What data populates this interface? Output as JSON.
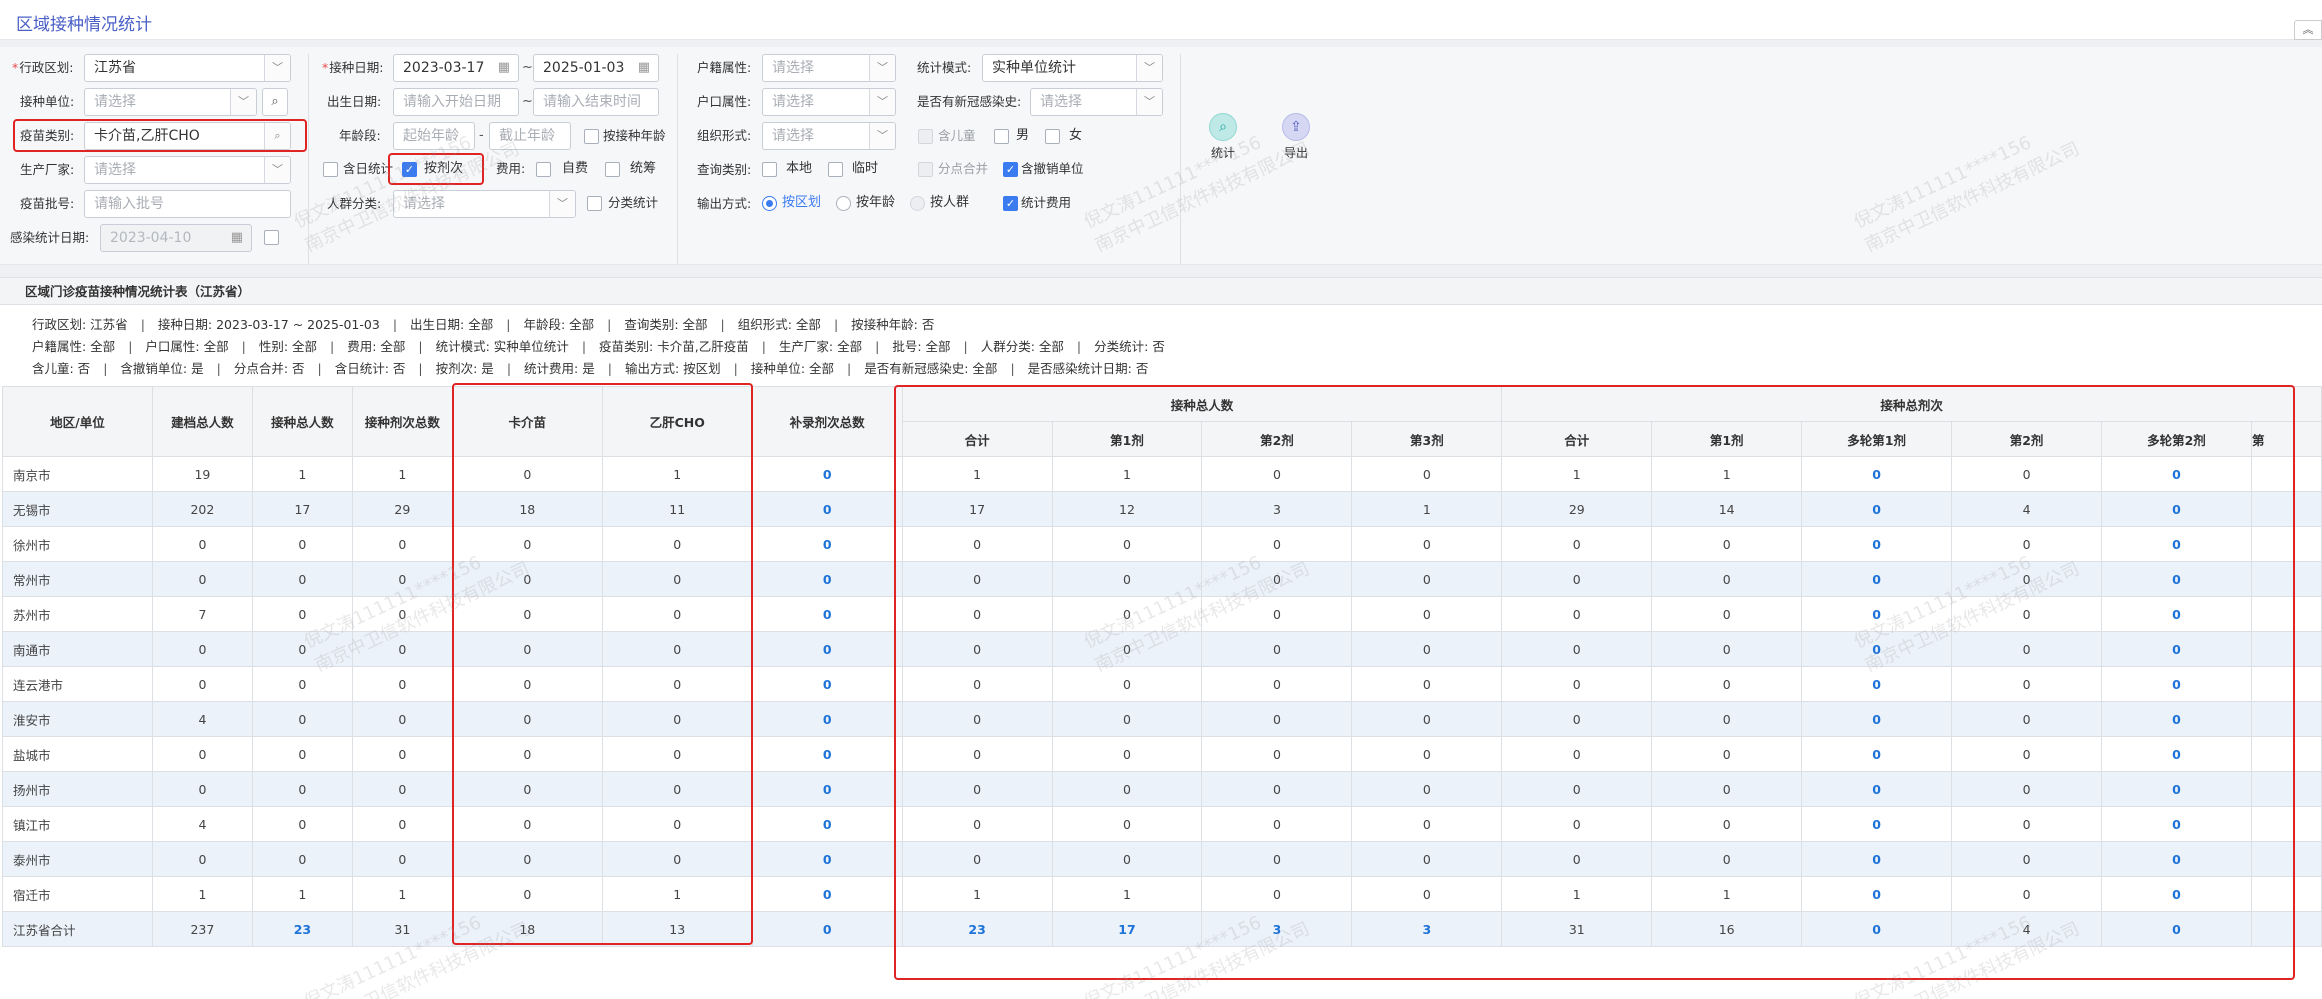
{
  "page": {
    "title": "区域接种情况统计",
    "collapse_icon": "chevrons-up-icon"
  },
  "filters": {
    "region_label": "行政区划:",
    "region_value": "江苏省",
    "unit_label": "接种单位:",
    "unit_ph": "请选择",
    "vaccine_type_label": "疫苗类别:",
    "vaccine_type_value": "卡介苗,乙肝CHO",
    "manufacturer_label": "生产厂家:",
    "manufacturer_ph": "请选择",
    "batch_label": "疫苗批号:",
    "batch_ph": "请输入批号",
    "infect_date_label": "感染统计日期:",
    "infect_date_value": "2023-04-10",
    "vacc_date_label": "接种日期:",
    "vacc_date_start": "2023-03-17",
    "vacc_date_end": "2025-01-03",
    "birth_label": "出生日期:",
    "birth_start_ph": "请输入开始日期",
    "birth_end_ph": "请输入结束时间",
    "age_label": "年龄段:",
    "age_start_ph": "起始年龄",
    "age_end_ph": "截止年龄",
    "by_vacc_age": "按接种年龄",
    "same_day": "含日统计",
    "by_dose": "按剂次",
    "fee_label": "费用:",
    "self_pay": "自费",
    "coord": "统筹",
    "crowd_label": "人群分类:",
    "crowd_ph": "请选择",
    "class_stat": "分类统计",
    "household_attr_label": "户籍属性:",
    "household_attr_ph": "请选择",
    "hukou_attr_label": "户口属性:",
    "hukou_attr_ph": "请选择",
    "org_form_label": "组织形式:",
    "org_form_ph": "请选择",
    "query_type_label": "查询类别:",
    "local": "本地",
    "temp": "临时",
    "output_label": "输出方式:",
    "by_region": "按区划",
    "by_age": "按年龄",
    "by_crowd": "按人群",
    "stat_mode_label": "统计模式:",
    "stat_mode_value": "实种单位统计",
    "covid_label": "是否有新冠感染史:",
    "covid_ph": "请选择",
    "child": "含儿童",
    "male": "男",
    "female": "女",
    "split_point": "分点合并",
    "cancel_unit": "含撤销单位",
    "stat_fee": "统计费用",
    "tilde": "~",
    "dash": "-"
  },
  "actions": {
    "stat": "统计",
    "export": "导出",
    "stat_icon": "search-icon",
    "export_icon": "upload-icon"
  },
  "report": {
    "title": "区域门诊疫苗接种情况统计表（江苏省）",
    "cond_rows": [
      [
        "行政区划: 江苏省",
        "接种日期: 2023-03-17 ~ 2025-01-03",
        "出生日期: 全部",
        "年龄段: 全部",
        "查询类别: 全部",
        "组织形式: 全部",
        "按接种年龄: 否"
      ],
      [
        "户籍属性: 全部",
        "户口属性: 全部",
        "性别: 全部",
        "费用: 全部",
        "统计模式: 实种单位统计",
        "疫苗类别: 卡介苗,乙肝疫苗",
        "生产厂家: 全部",
        "批号: 全部",
        "人群分类: 全部",
        "分类统计: 否"
      ],
      [
        "含儿童: 否",
        "含撤销单位: 是",
        "分点合并: 否",
        "含日统计: 否",
        "按剂次: 是",
        "统计费用: 是",
        "输出方式: 按区划",
        "接种单位: 全部",
        "是否有新冠感染史: 全部",
        "是否感染统计日期: 否"
      ]
    ],
    "headers": {
      "area": "地区/单位",
      "filed": "建档总人数",
      "vacc_people": "接种总人数",
      "vacc_doses": "接种剂次总数",
      "bcg": "卡介苗",
      "hepb": "乙肝CHO",
      "supp": "补录剂次总数",
      "group_people": "接种总人数",
      "group_doses": "接种总剂次",
      "sub_people": [
        "合计",
        "第1剂",
        "第2剂",
        "第3剂"
      ],
      "sub_doses": [
        "合计",
        "第1剂",
        "多轮第1剂",
        "第2剂",
        "多轮第2剂",
        "第"
      ]
    },
    "rows": [
      [
        "南京市",
        "19",
        "1",
        "1",
        "0",
        "1",
        "0",
        "1",
        "1",
        "0",
        "0",
        "1",
        "1",
        "0",
        "0",
        "0"
      ],
      [
        "无锡市",
        "202",
        "17",
        "29",
        "18",
        "11",
        "0",
        "17",
        "12",
        "3",
        "1",
        "29",
        "14",
        "0",
        "4",
        "0"
      ],
      [
        "徐州市",
        "0",
        "0",
        "0",
        "0",
        "0",
        "0",
        "0",
        "0",
        "0",
        "0",
        "0",
        "0",
        "0",
        "0",
        "0"
      ],
      [
        "常州市",
        "0",
        "0",
        "0",
        "0",
        "0",
        "0",
        "0",
        "0",
        "0",
        "0",
        "0",
        "0",
        "0",
        "0",
        "0"
      ],
      [
        "苏州市",
        "7",
        "0",
        "0",
        "0",
        "0",
        "0",
        "0",
        "0",
        "0",
        "0",
        "0",
        "0",
        "0",
        "0",
        "0"
      ],
      [
        "南通市",
        "0",
        "0",
        "0",
        "0",
        "0",
        "0",
        "0",
        "0",
        "0",
        "0",
        "0",
        "0",
        "0",
        "0",
        "0"
      ],
      [
        "连云港市",
        "0",
        "0",
        "0",
        "0",
        "0",
        "0",
        "0",
        "0",
        "0",
        "0",
        "0",
        "0",
        "0",
        "0",
        "0"
      ],
      [
        "淮安市",
        "4",
        "0",
        "0",
        "0",
        "0",
        "0",
        "0",
        "0",
        "0",
        "0",
        "0",
        "0",
        "0",
        "0",
        "0"
      ],
      [
        "盐城市",
        "0",
        "0",
        "0",
        "0",
        "0",
        "0",
        "0",
        "0",
        "0",
        "0",
        "0",
        "0",
        "0",
        "0",
        "0"
      ],
      [
        "扬州市",
        "0",
        "0",
        "0",
        "0",
        "0",
        "0",
        "0",
        "0",
        "0",
        "0",
        "0",
        "0",
        "0",
        "0",
        "0"
      ],
      [
        "镇江市",
        "4",
        "0",
        "0",
        "0",
        "0",
        "0",
        "0",
        "0",
        "0",
        "0",
        "0",
        "0",
        "0",
        "0",
        "0"
      ],
      [
        "泰州市",
        "0",
        "0",
        "0",
        "0",
        "0",
        "0",
        "0",
        "0",
        "0",
        "0",
        "0",
        "0",
        "0",
        "0",
        "0"
      ],
      [
        "宿迁市",
        "1",
        "1",
        "1",
        "0",
        "1",
        "0",
        "1",
        "1",
        "0",
        "0",
        "1",
        "1",
        "0",
        "0",
        "0"
      ],
      [
        "江苏省合计",
        "237",
        "23",
        "31",
        "18",
        "13",
        "0",
        "23",
        "17",
        "3",
        "3",
        "31",
        "16",
        "0",
        "4",
        "0"
      ]
    ]
  },
  "watermark": {
    "line1": "倪文涛111111****156",
    "line2": "南京中卫信软件科技有限公司"
  },
  "colors": {
    "accent": "#3a7bf0",
    "link": "#1e73d8",
    "highlight": "#e02424",
    "title": "#4a5fc7"
  }
}
